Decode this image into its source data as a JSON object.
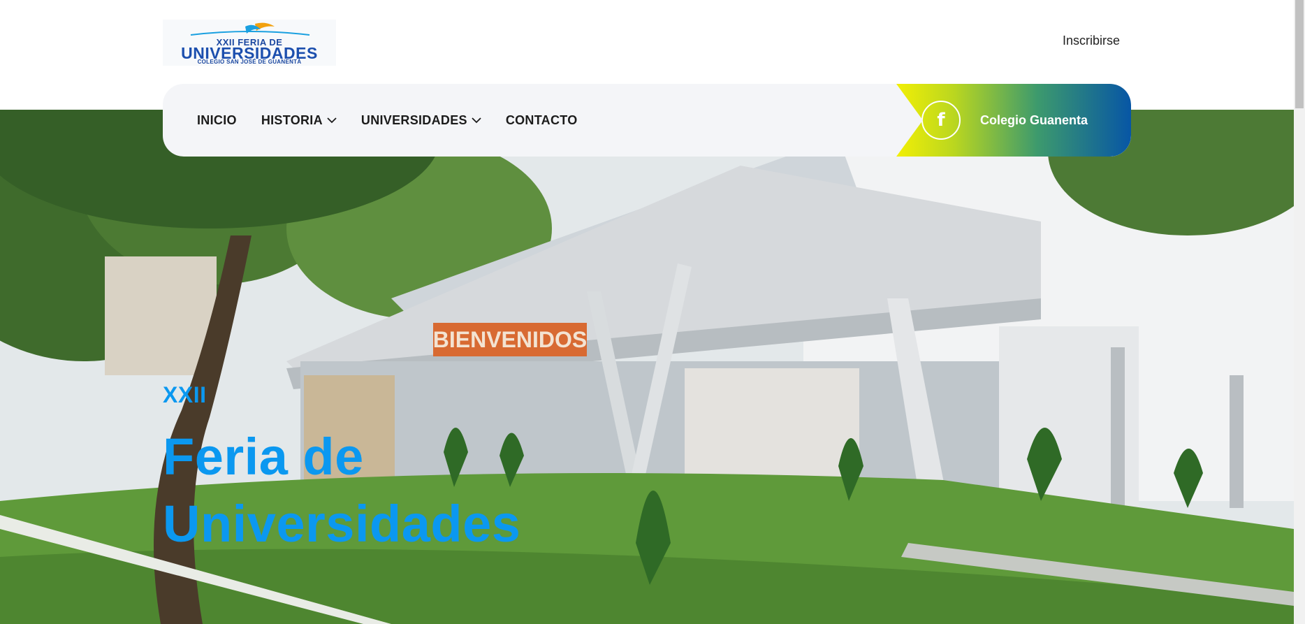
{
  "header": {
    "logo": {
      "line1": "XXII FERIA DE",
      "line2": "UNIVERSIDADES",
      "line3": "COLEGIO SAN JOSÉ DE GUANENTÁ"
    },
    "signup_label": "Inscribirse"
  },
  "nav": {
    "items": [
      {
        "label": "INICIO",
        "has_dropdown": false
      },
      {
        "label": "HISTORIA",
        "has_dropdown": true
      },
      {
        "label": "UNIVERSIDADES",
        "has_dropdown": true
      },
      {
        "label": "CONTACTO",
        "has_dropdown": false
      }
    ],
    "social": {
      "icon": "facebook-icon",
      "glyph": "f",
      "label": "Colegio Guanenta"
    }
  },
  "hero": {
    "kicker": "XXII",
    "headline_line1": "Feria de",
    "headline_line2": "Universidades",
    "image": "building-photo",
    "sign_text": "BIENVENIDOS"
  },
  "colors": {
    "accent": "#0b98f0",
    "nav_bg": "#f4f5f8",
    "gradient_start": "#f2ef05",
    "gradient_end": "#0756a5",
    "logo_blue": "#1c4fae"
  }
}
